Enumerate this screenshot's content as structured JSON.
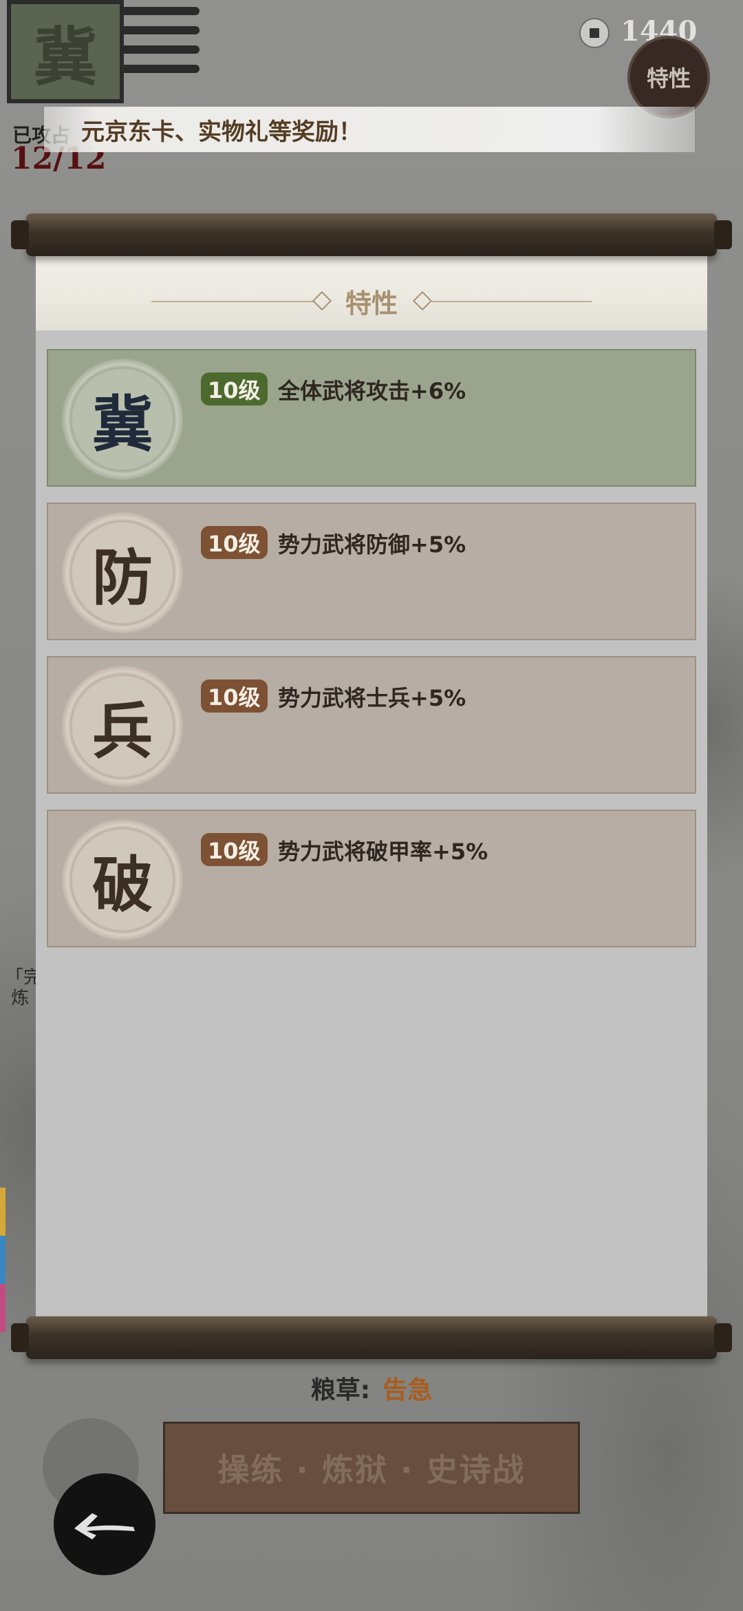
{
  "header": {
    "city_emblem_char": "冀",
    "attack_label": "已攻占",
    "attack_count": "12/12",
    "coin_amount": "1440",
    "trait_badge_label": "特性"
  },
  "banner": {
    "text": "元京东卡、实物礼等奖励！"
  },
  "side_text": "「完\n 炼",
  "panel": {
    "title": "特性",
    "traits": [
      {
        "icon_char": "冀",
        "level": "10级",
        "description": "全体武将攻击+6%",
        "active": true
      },
      {
        "icon_char": "防",
        "level": "10级",
        "description": "势力武将防御+5%",
        "active": false
      },
      {
        "icon_char": "兵",
        "level": "10级",
        "description": "势力武将士兵+5%",
        "active": false
      },
      {
        "icon_char": "破",
        "level": "10级",
        "description": "势力武将破甲率+5%",
        "active": false
      }
    ]
  },
  "footer": {
    "grain_label": "粮草:",
    "grain_value": "告急",
    "action_button": "操练 · 炼狱 · 史诗战"
  },
  "colors": {
    "active_card": "#9ba58d",
    "inactive_card": "#b6ada4",
    "active_level_tag": "#4d6a2e",
    "inactive_level_tag": "#7d5133",
    "grain_warning": "#b3621c",
    "tab_colors": [
      "#e2b53b",
      "#3a8fd0",
      "#d0508a"
    ]
  }
}
